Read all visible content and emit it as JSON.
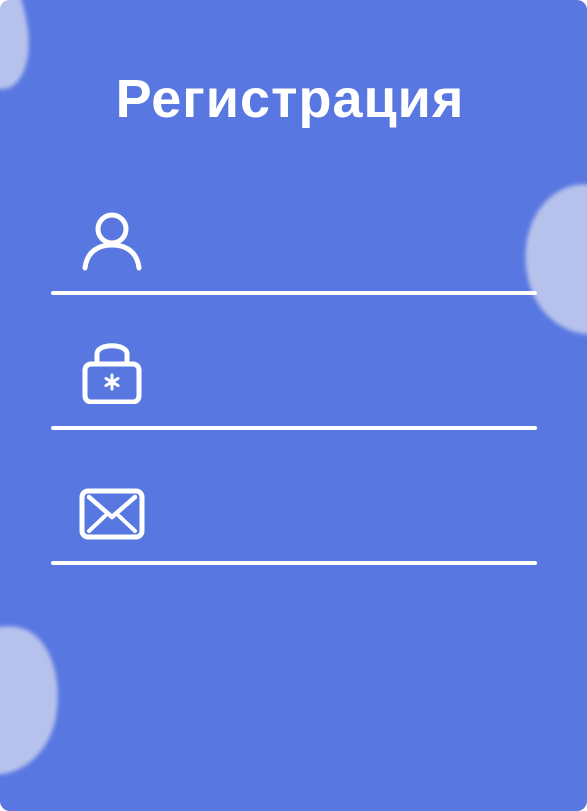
{
  "form": {
    "title": "Регистрация",
    "fields": [
      {
        "id": "username",
        "icon": "user-icon",
        "value": "",
        "placeholder": ""
      },
      {
        "id": "password",
        "icon": "lock-icon",
        "value": "",
        "placeholder": ""
      },
      {
        "id": "email",
        "icon": "mail-icon",
        "value": "",
        "placeholder": ""
      }
    ]
  },
  "colors": {
    "background": "#5877e1",
    "foreground": "#ffffff",
    "blob": "#b7c2ec"
  }
}
